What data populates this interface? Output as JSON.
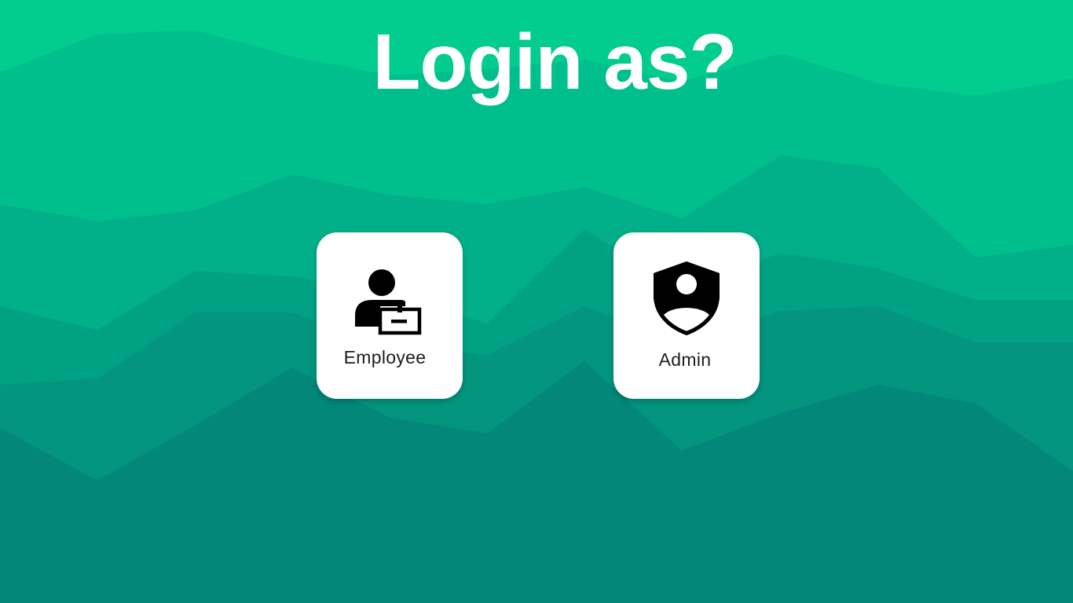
{
  "page": {
    "title": "Login as?"
  },
  "roles": [
    {
      "label": "Employee",
      "icon": "employee-badge-icon"
    },
    {
      "label": "Admin",
      "icon": "admin-shield-icon"
    }
  ],
  "colors": {
    "background_top": "#02cc8e",
    "background_bottom": "#028373",
    "card": "#ffffff",
    "title": "#ffffff",
    "label": "#1d1d1d",
    "icon": "#000000"
  }
}
